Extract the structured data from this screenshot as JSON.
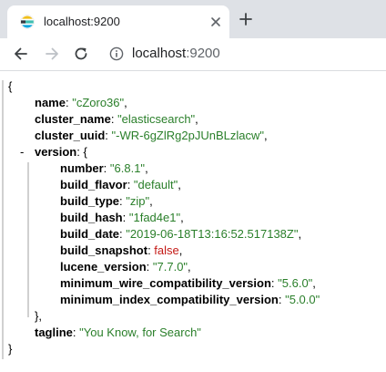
{
  "tab": {
    "title": "localhost:9200",
    "favicon": "elasticsearch-favicon"
  },
  "toolbar": {
    "address_host": "localhost",
    "address_port": ":9200"
  },
  "json": {
    "open_brace": "{",
    "close_brace": "}",
    "name_key": "name",
    "name_value": "\"cZoro36\"",
    "cluster_name_key": "cluster_name",
    "cluster_name_value": "\"elasticsearch\"",
    "cluster_uuid_key": "cluster_uuid",
    "cluster_uuid_value": "\"-WR-6gZlRg2pJUnBLzlacw\"",
    "version_toggle": "-",
    "version_key": "version",
    "version_open": "{",
    "number_key": "number",
    "number_value": "\"6.8.1\"",
    "build_flavor_key": "build_flavor",
    "build_flavor_value": "\"default\"",
    "build_type_key": "build_type",
    "build_type_value": "\"zip\"",
    "build_hash_key": "build_hash",
    "build_hash_value": "\"1fad4e1\"",
    "build_date_key": "build_date",
    "build_date_value": "\"2019-06-18T13:16:52.517138Z\"",
    "build_snapshot_key": "build_snapshot",
    "build_snapshot_value": "false",
    "lucene_version_key": "lucene_version",
    "lucene_version_value": "\"7.7.0\"",
    "min_wire_key": "minimum_wire_compatibility_version",
    "min_wire_value": "\"5.6.0\"",
    "min_index_key": "minimum_index_compatibility_version",
    "min_index_value": "\"5.0.0\"",
    "version_close": "},",
    "tagline_key": "tagline",
    "tagline_value": "\"You Know, for Search\""
  },
  "colors": {
    "string": "#2a7f2a",
    "boolean": "#c41a16",
    "bracket_bar_outer": "#cccccc",
    "bracket_bar_inner": "#cccccc"
  }
}
